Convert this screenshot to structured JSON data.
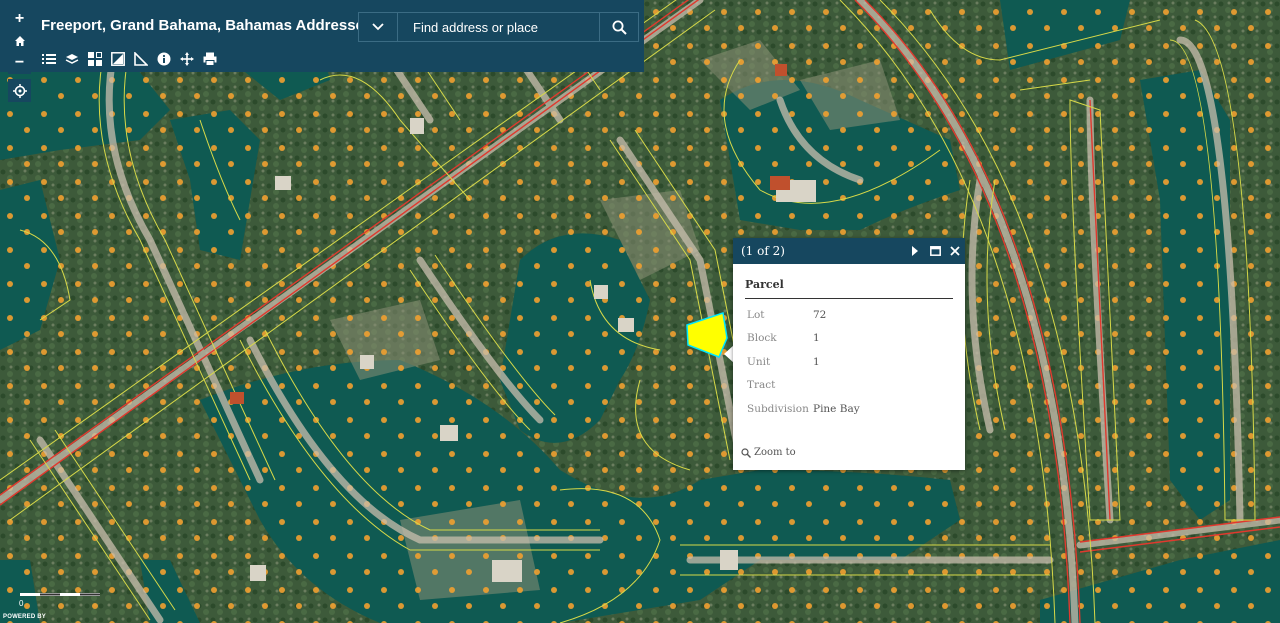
{
  "header": {
    "title": "Freeport, Grand Bahama, Bahamas Addresses",
    "zoom_in": "+",
    "zoom_out": "−"
  },
  "search": {
    "placeholder": "Find address or place"
  },
  "toolbar": {
    "icons": [
      "list-icon",
      "layers-icon",
      "basemap-icon",
      "overview-icon",
      "measure-icon",
      "info-icon",
      "pan-icon",
      "print-icon"
    ]
  },
  "popup": {
    "count": "(1 of 2)",
    "title": "Parcel",
    "attributes": [
      {
        "key": "Lot",
        "value": "72"
      },
      {
        "key": "Block",
        "value": "1"
      },
      {
        "key": "Unit",
        "value": "1"
      },
      {
        "key": "Tract",
        "value": ""
      },
      {
        "key": "Subdivision",
        "value": "Pine Bay"
      }
    ],
    "zoom_to": "Zoom to"
  },
  "scale": {
    "label": "0"
  },
  "attribution": "POWERED BY",
  "colors": {
    "header_bg": "#16475f",
    "parcel_line": "#d7d948",
    "road_line": "#e0392e",
    "selected_parcel": "#ffff00",
    "address_marker": "#f0a030"
  }
}
